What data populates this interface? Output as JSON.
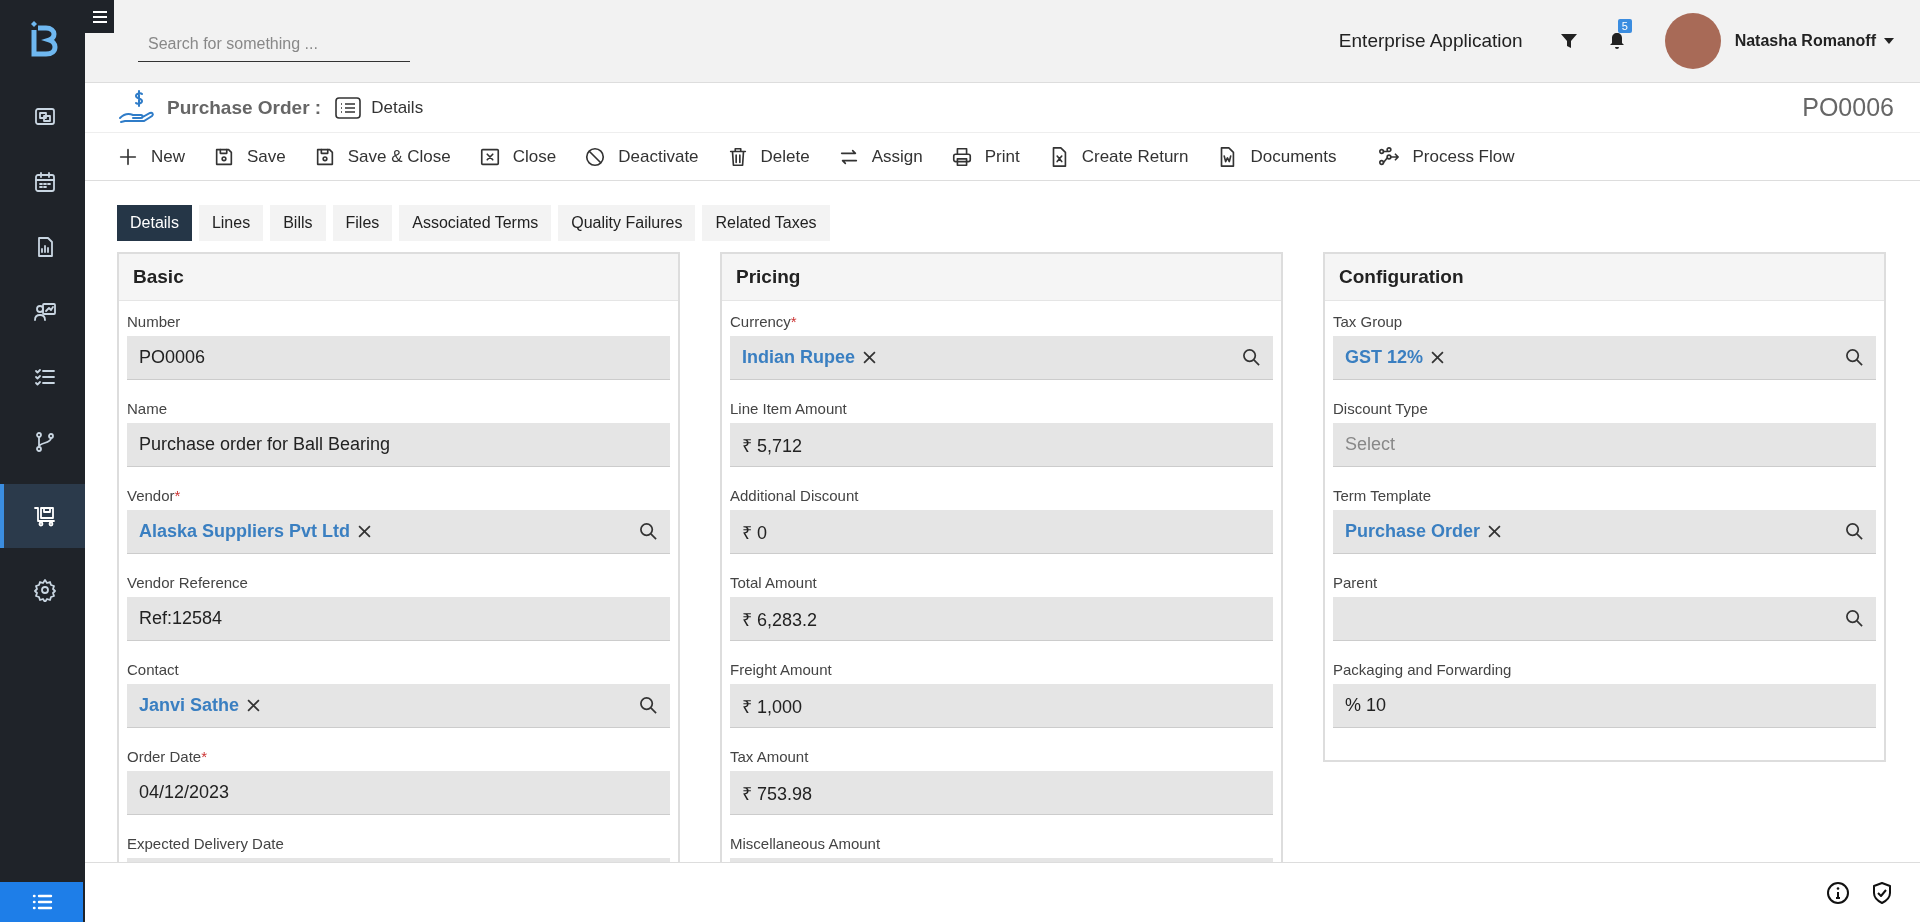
{
  "sidebar": {
    "items": [
      {
        "selected": false
      },
      {
        "selected": false
      },
      {
        "selected": false
      },
      {
        "selected": false
      },
      {
        "selected": false
      },
      {
        "selected": false
      },
      {
        "selected": true
      },
      {
        "selected": false
      }
    ]
  },
  "topbar": {
    "search": {
      "placeholder": "Search for something ..."
    },
    "app_name": "Enterprise Application",
    "notifications": "5",
    "user": "Natasha Romanoff"
  },
  "header": {
    "title": "Purchase Order :",
    "view": "Details",
    "record_id": "PO0006"
  },
  "toolbar": [
    "New",
    "Save",
    "Save & Close",
    "Close",
    "Deactivate",
    "Delete",
    "Assign",
    "Print",
    "Create Return",
    "Documents",
    "Process Flow"
  ],
  "tabs": [
    {
      "label": "Details",
      "selected": true
    },
    {
      "label": "Lines",
      "selected": false
    },
    {
      "label": "Bills",
      "selected": false
    },
    {
      "label": "Files",
      "selected": false
    },
    {
      "label": "Associated Terms",
      "selected": false
    },
    {
      "label": "Quality Failures",
      "selected": false
    },
    {
      "label": "Related Taxes",
      "selected": false
    }
  ],
  "panels": [
    {
      "title": "Basic",
      "fields": [
        {
          "label": "Number",
          "kind": "text",
          "value": "PO0006"
        },
        {
          "label": "Name",
          "kind": "text",
          "value": "Purchase order for Ball Bearing"
        },
        {
          "label": "Vendor",
          "kind": "lookup",
          "required_mark": "*",
          "value": "Alaska Suppliers Pvt Ltd"
        },
        {
          "label": "Vendor Reference",
          "kind": "text",
          "value": "Ref:12584"
        },
        {
          "label": "Contact",
          "kind": "lookup",
          "value": "Janvi Sathe"
        },
        {
          "label": "Order Date",
          "kind": "text",
          "required_mark": "*",
          "value": "04/12/2023"
        },
        {
          "label": "Expected Delivery Date",
          "kind": "text"
        }
      ]
    },
    {
      "title": "Pricing",
      "fields": [
        {
          "label": "Currency",
          "kind": "lookup",
          "required_mark": "*",
          "value": "Indian Rupee"
        },
        {
          "label": "Line Item Amount",
          "kind": "text",
          "value": "₹ 5,712"
        },
        {
          "label": "Additional Discount",
          "kind": "text",
          "value": "₹ 0"
        },
        {
          "label": "Total Amount",
          "kind": "text",
          "value": "₹ 6,283.2"
        },
        {
          "label": "Freight Amount",
          "kind": "text",
          "value": "₹ 1,000"
        },
        {
          "label": "Tax Amount",
          "kind": "text",
          "value": "₹ 753.98"
        },
        {
          "label": "Miscellaneous Amount",
          "kind": "text"
        }
      ]
    },
    {
      "title": "Configuration",
      "fields": [
        {
          "label": "Tax Group",
          "kind": "lookup",
          "value": "GST 12%"
        },
        {
          "label": "Discount Type",
          "kind": "select",
          "placeholder": "Select"
        },
        {
          "label": "Term Template",
          "kind": "lookup",
          "value": "Purchase Order"
        },
        {
          "label": "Parent",
          "kind": "lookup"
        },
        {
          "label": "Packaging and Forwarding",
          "kind": "text",
          "value": "% 10"
        }
      ]
    }
  ]
}
